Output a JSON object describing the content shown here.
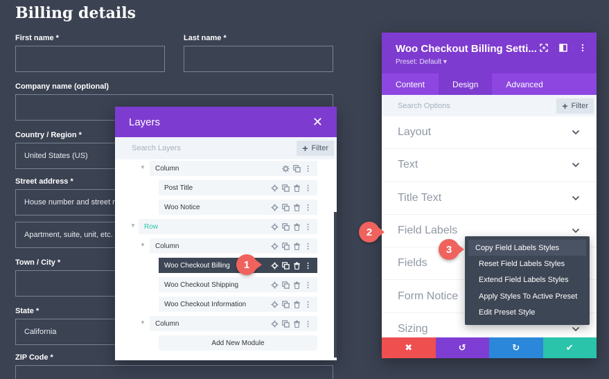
{
  "billing": {
    "title": "Billing details",
    "first_name_label": "First name *",
    "last_name_label": "Last name *",
    "company_label": "Company name (optional)",
    "country_label": "Country / Region *",
    "country_value": "United States (US)",
    "street_label": "Street address *",
    "street_placeholder_1": "House number and street name",
    "street_placeholder_2": "Apartment, suite, unit, etc. (optional)",
    "city_label": "Town / City *",
    "state_label": "State *",
    "state_value": "California",
    "zip_label": "ZIP Code *"
  },
  "layers": {
    "title": "Layers",
    "search_placeholder": "Search Layers",
    "filter_label": "Filter",
    "rows": [
      {
        "name": "Column"
      },
      {
        "name": "Post Title"
      },
      {
        "name": "Woo Notice"
      },
      {
        "name": "Row"
      },
      {
        "name": "Column"
      },
      {
        "name": "Woo Checkout Billing"
      },
      {
        "name": "Woo Checkout Shipping"
      },
      {
        "name": "Woo Checkout Information"
      },
      {
        "name": "Column"
      }
    ],
    "add_module_label": "Add New Module"
  },
  "settings": {
    "title": "Woo Checkout Billing Setti...",
    "preset": "Preset: Default ▾",
    "tabs": [
      {
        "label": "Content"
      },
      {
        "label": "Design"
      },
      {
        "label": "Advanced"
      }
    ],
    "search_placeholder": "Search Options",
    "filter_label": "Filter",
    "groups": [
      {
        "label": "Layout"
      },
      {
        "label": "Text"
      },
      {
        "label": "Title Text"
      },
      {
        "label": "Field Labels"
      },
      {
        "label": "Fields"
      },
      {
        "label": "Form Notice"
      },
      {
        "label": "Sizing"
      }
    ],
    "footer": {
      "cancel": "✖",
      "undo": "↺",
      "redo": "↻",
      "save": "✔"
    }
  },
  "context_menu": {
    "items": [
      {
        "label": "Copy Field Labels Styles"
      },
      {
        "label": "Reset Field Labels Styles"
      },
      {
        "label": "Extend Field Labels Styles"
      },
      {
        "label": "Apply Styles To Active Preset"
      },
      {
        "label": "Edit Preset Style"
      }
    ]
  },
  "badges": {
    "one": "1",
    "two": "2",
    "three": "3"
  },
  "colors": {
    "purple": "#7e3bd0",
    "purple_tab": "#8d47e0",
    "dark_bg": "#3b4252",
    "cancel_red": "#ef4f4f",
    "undo_purple": "#7f3ed3",
    "redo_blue": "#2b87da",
    "save_green": "#29c4a9",
    "badge": "#f0625d"
  }
}
